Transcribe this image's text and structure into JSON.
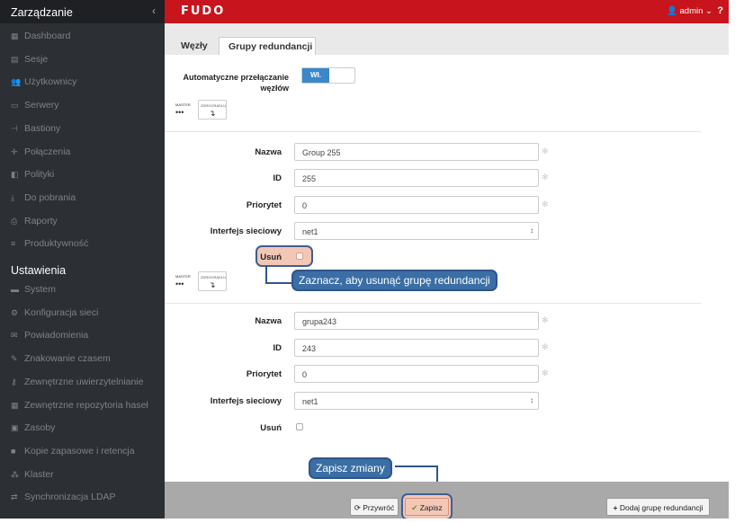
{
  "sidebar": {
    "section_manage": "Zarządzanie",
    "collapse_icon": "chevron-left-icon",
    "manage_items": [
      {
        "label": "Dashboard",
        "icon": "dashboard-icon",
        "glyph": "▦"
      },
      {
        "label": "Sesje",
        "icon": "sessions-icon",
        "glyph": "▤"
      },
      {
        "label": "Użytkownicy",
        "icon": "users-icon",
        "glyph": "👥"
      },
      {
        "label": "Serwery",
        "icon": "servers-icon",
        "glyph": "▭"
      },
      {
        "label": "Bastiony",
        "icon": "bastions-icon",
        "glyph": "⊣"
      },
      {
        "label": "Połączenia",
        "icon": "connections-icon",
        "glyph": "✛"
      },
      {
        "label": "Polityki",
        "icon": "policies-icon",
        "glyph": "◧"
      },
      {
        "label": "Do pobrania",
        "icon": "download-icon",
        "glyph": "⤓"
      },
      {
        "label": "Raporty",
        "icon": "reports-icon",
        "glyph": "⎙"
      },
      {
        "label": "Produktywność",
        "icon": "productivity-icon",
        "glyph": "≡"
      }
    ],
    "section_settings": "Ustawienia",
    "settings_items": [
      {
        "label": "System",
        "icon": "folder-icon",
        "glyph": "▬"
      },
      {
        "label": "Konfiguracja sieci",
        "icon": "network-config-icon",
        "glyph": "⚙"
      },
      {
        "label": "Powiadomienia",
        "icon": "notifications-icon",
        "glyph": "✉"
      },
      {
        "label": "Znakowanie czasem",
        "icon": "timestamp-icon",
        "glyph": "✎"
      },
      {
        "label": "Zewnętrzne uwierzytelnianie",
        "icon": "external-auth-icon",
        "glyph": "⚷"
      },
      {
        "label": "Zewnętrzne repozytoria haseł",
        "icon": "password-repo-icon",
        "glyph": "▦"
      },
      {
        "label": "Zasoby",
        "icon": "resources-icon",
        "glyph": "▣"
      },
      {
        "label": "Kopie zapasowe i retencja",
        "icon": "backup-icon",
        "glyph": "■"
      },
      {
        "label": "Klaster",
        "icon": "cluster-icon",
        "glyph": "⁂"
      },
      {
        "label": "Synchronizacja LDAP",
        "icon": "ldap-sync-icon",
        "glyph": "⇄"
      }
    ]
  },
  "topbar": {
    "logo": "FUDO",
    "user": "admin",
    "user_icon": "user-icon",
    "help": "?",
    "accent": "#c8141c"
  },
  "tabs": [
    "Węzły",
    "Grupy redundancji"
  ],
  "failover": {
    "label_line1": "Automatyczne przełączanie",
    "label_line2": "węzłów",
    "toggle_on": "Wł."
  },
  "nodes": {
    "master": "MASTER",
    "master_value": "•••",
    "slave": "ZDROGRADLU",
    "slave_value": "↴"
  },
  "labels": {
    "name": "Nazwa",
    "id": "ID",
    "priority": "Priorytet",
    "interface": "Interfejs sieciowy",
    "delete": "Usuń"
  },
  "groups": [
    {
      "name": "Group 255",
      "id": "255",
      "priority": "0",
      "interface": "net1"
    },
    {
      "name": "grupa243",
      "id": "243",
      "priority": "0",
      "interface": "net1"
    }
  ],
  "required_mark": "✻",
  "callouts": {
    "delete_hint": "Zaznacz, aby usunąć grupę redundancji",
    "save_hint": "Zapisz zmiany"
  },
  "footer": {
    "restore": "Przywróć",
    "save": "Zapisz",
    "add_group": "Dodaj grupę redundancji"
  }
}
